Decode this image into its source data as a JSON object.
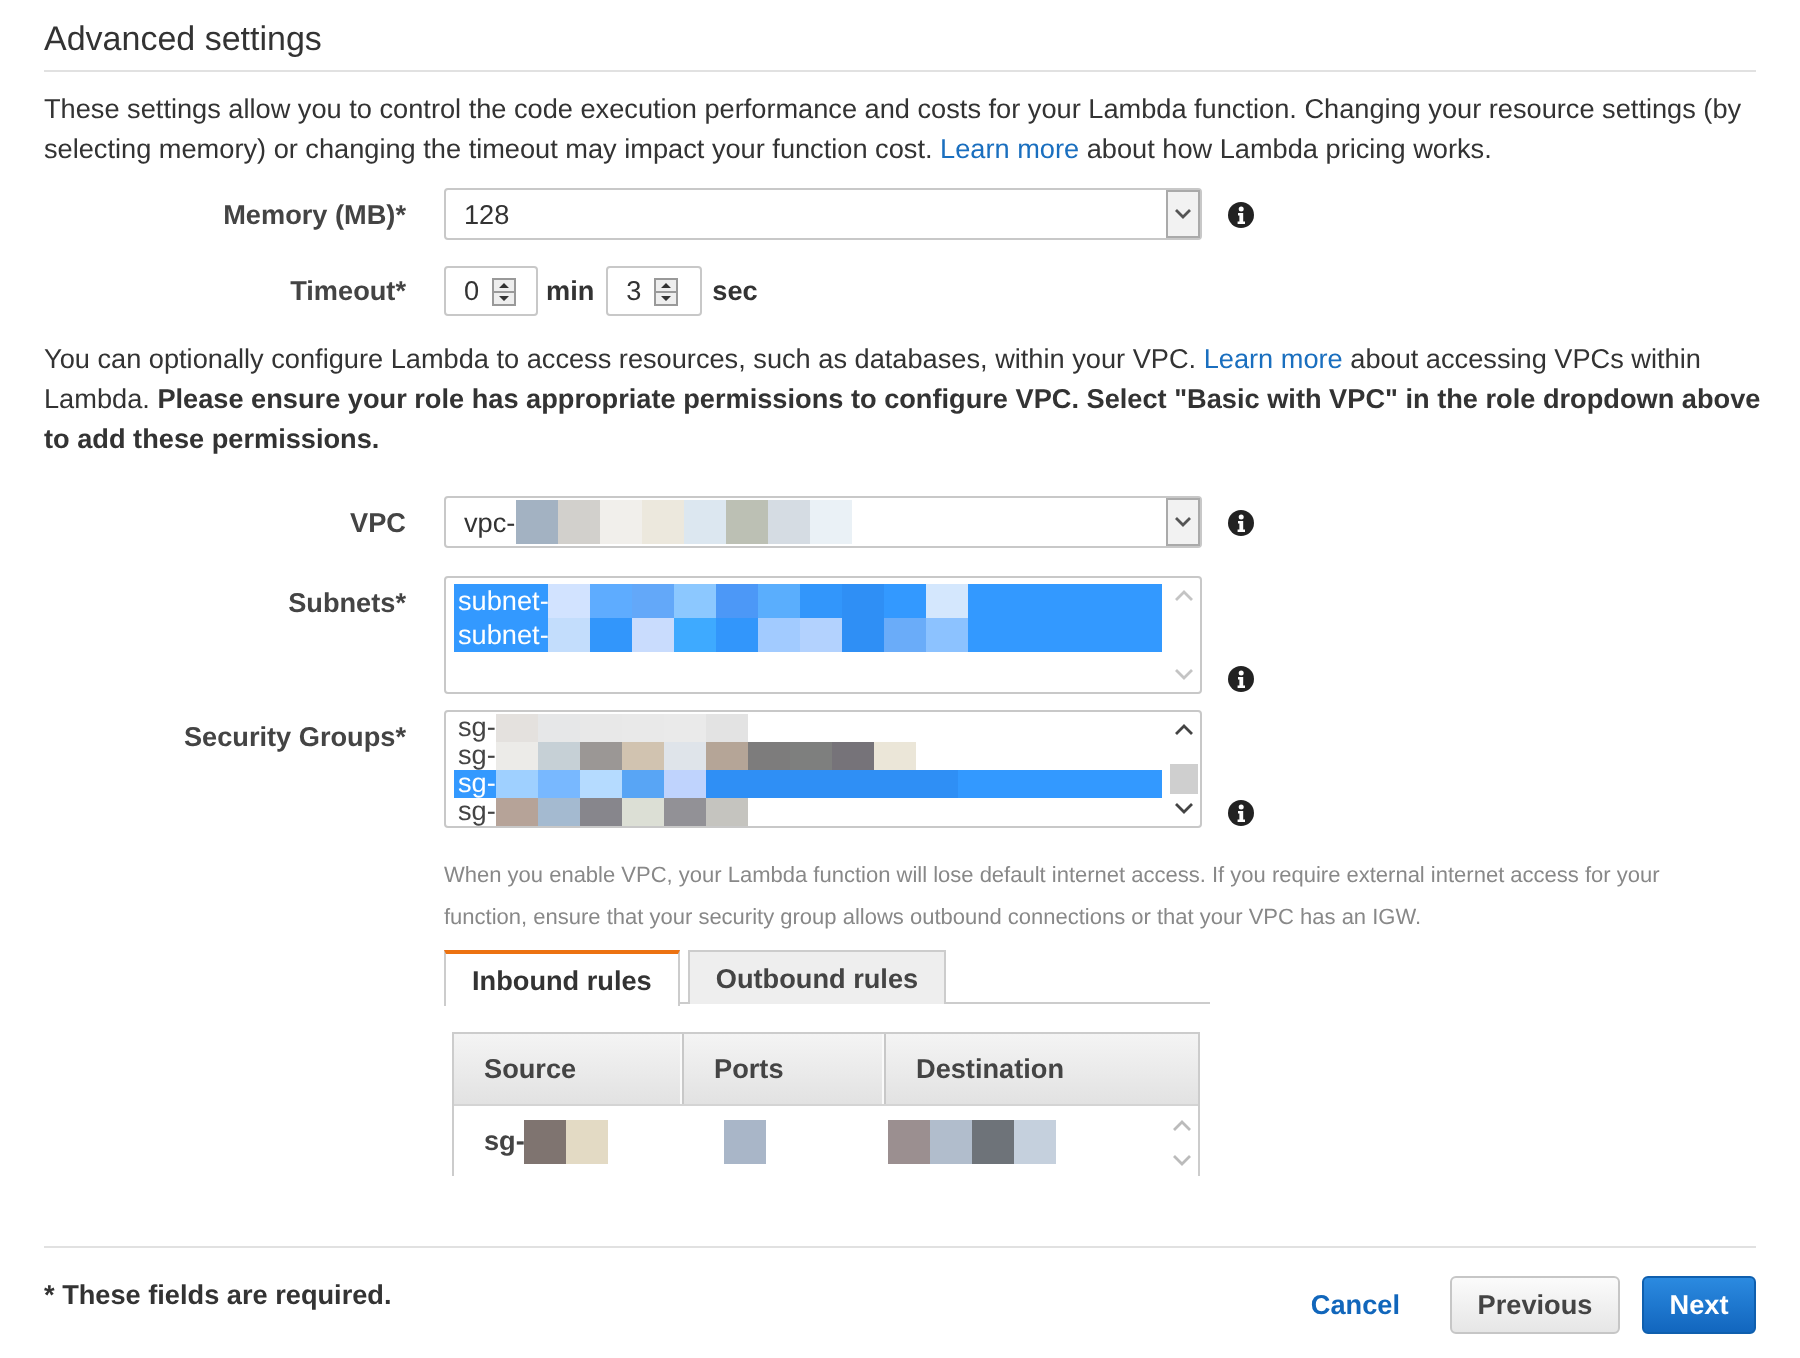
{
  "section": {
    "title": "Advanced settings"
  },
  "pricing_note": {
    "text": "These settings allow you to control the code execution performance and costs for your Lambda function. Changing your resource settings (by selecting memory) or changing the timeout may impact your function cost.",
    "link": "Learn more",
    "text_after": "about how Lambda pricing works."
  },
  "memory": {
    "label": "Memory (MB)*",
    "value": "128"
  },
  "timeout": {
    "label": "Timeout*",
    "minutes": "0",
    "minutes_unit": "min",
    "seconds": "3",
    "seconds_unit": "sec"
  },
  "vpc_note": {
    "text": "You can optionally configure Lambda to access resources, such as databases, within your VPC.",
    "link": "Learn more",
    "text_after": "about accessing VPCs within Lambda. **Please ensure your role has appropriate permissions to configure VPC. Select \"Basic with VPC\" in the role dropdown above to add these permissions.**"
  },
  "vpc": {
    "label": "VPC",
    "value": "vpc-",
    "redacted": true
  },
  "subnets": {
    "label": "Subnets*",
    "options": [
      {
        "text": "subnet-",
        "selected": true,
        "redacted": true
      },
      {
        "text": "subnet-",
        "selected": true,
        "redacted": true
      }
    ]
  },
  "security_groups": {
    "label": "Security Groups*",
    "options": [
      {
        "text": "sg-",
        "selected": false,
        "redacted": true
      },
      {
        "text": "sg-",
        "selected": false,
        "redacted": true
      },
      {
        "text": "sg-",
        "selected": true,
        "redacted": true
      },
      {
        "text": "sg-",
        "selected": false,
        "redacted": true
      }
    ]
  },
  "internet_warning": "When you enable VPC, your Lambda function will lose default internet access. If you require external internet access for your function, ensure that your security group allows outbound connections or that your VPC has an IGW.",
  "rule_tabs": [
    {
      "label": "Inbound rules",
      "selected": true
    },
    {
      "label": "Outbound rules",
      "selected": false
    }
  ],
  "rules_table": {
    "columns": [
      "Source",
      "Ports",
      "Destination"
    ],
    "rows": [
      {
        "cells": [
          {
            "text": "sg-",
            "redacted": true
          },
          {
            "redacted": true
          },
          {
            "redacted": true
          }
        ]
      }
    ]
  },
  "footer": {
    "required_note": "* These fields are required.",
    "cancel": "Cancel",
    "buttons": [
      {
        "label": "Previous",
        "kind": "secondary"
      },
      {
        "label": "Next",
        "kind": "primary"
      }
    ]
  }
}
